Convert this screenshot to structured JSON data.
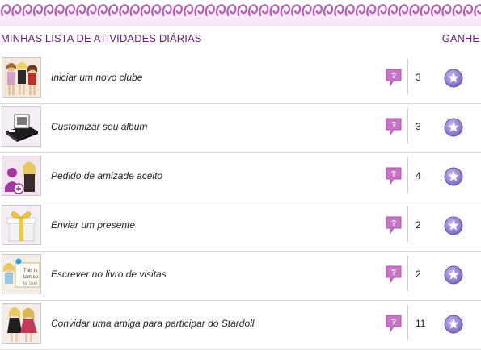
{
  "header": {
    "title": "MINHAS LISTA DE ATIVIDADES DIÁRIAS",
    "earn_label": "GANHE"
  },
  "activities": [
    {
      "label": "Iniciar um novo clube",
      "points": "3",
      "icon": "club-dolls-thumbnail"
    },
    {
      "label": "Customizar seu álbum",
      "points": "3",
      "icon": "album-thumbnail"
    },
    {
      "label": "Pedido de amizade aceito",
      "points": "4",
      "icon": "friend-request-thumbnail"
    },
    {
      "label": "Enviar um presente",
      "points": "2",
      "icon": "gift-thumbnail"
    },
    {
      "label": "Escrever no livro de visitas",
      "points": "2",
      "icon": "guestbook-thumbnail",
      "thumb_text": [
        "This is",
        "tam so",
        "by User"
      ]
    },
    {
      "label": "Convidar uma amiga para participar do Stardoll",
      "points": "11",
      "icon": "invite-friend-thumbnail"
    }
  ],
  "colors": {
    "accent": "#6a1f74",
    "help_icon": "#c974c9",
    "star_badge": "#8c74c9",
    "spiral": "#b45bb4"
  }
}
